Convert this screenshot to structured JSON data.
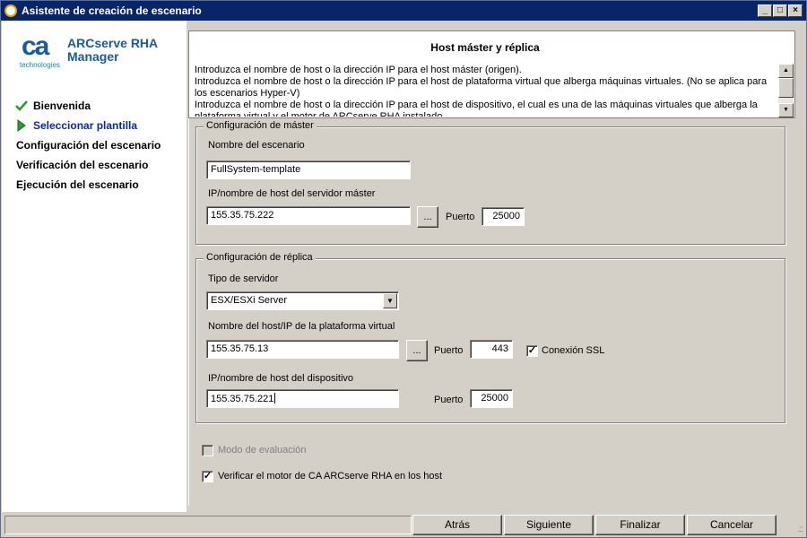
{
  "window": {
    "title": "Asistente de creación de escenario",
    "controls": {
      "minimize": "_",
      "maximize": "□",
      "close": "×"
    }
  },
  "logo": {
    "mark": "ca",
    "sub": "technologies",
    "product_line1": "ARCserve RHA",
    "product_line2": "Manager"
  },
  "nav": {
    "items": [
      {
        "label": "Bienvenida",
        "state": "done",
        "icon": "checkmark-icon"
      },
      {
        "label": "Seleccionar plantilla",
        "state": "current",
        "icon": "arrow-right-icon"
      },
      {
        "label": "Configuración del escenario",
        "state": "pending"
      },
      {
        "label": "Verificación del escenario",
        "state": "pending"
      },
      {
        "label": "Ejecución del escenario",
        "state": "pending"
      }
    ]
  },
  "header": {
    "title": "Host máster y réplica",
    "description_lines": [
      "Introduzca el nombre de host o la dirección IP para el host máster (origen).",
      "Introduzca el nombre de host o la dirección IP para el host de plataforma virtual que alberga máquinas virtuales. (No se aplica para los escenarios Hyper-V)",
      "Introduzca el nombre de host o la dirección IP para el host de dispositivo, el cual es una de las máquinas virtuales que alberga la plataforma virtual y el motor de ARCserve RHA instalado."
    ]
  },
  "master": {
    "group_label": "Configuración de máster",
    "scenario_name_label": "Nombre del escenario",
    "scenario_name_value": "FullSystem-template",
    "host_label": "IP/nombre de host del servidor máster",
    "host_value": "155.35.75.222",
    "browse_label": "...",
    "port_label": "Puerto",
    "port_value": "25000"
  },
  "replica": {
    "group_label": "Configuración de réplica",
    "server_type_label": "Tipo de servidor",
    "server_type_value": "ESX/ESXi Server",
    "virtual_host_label": "Nombre del host/IP de la plataforma virtual",
    "virtual_host_value": "155.35.75.13",
    "browse_label": "...",
    "virtual_port_label": "Puerto",
    "virtual_port_value": "443",
    "ssl_label": "Conexión SSL",
    "ssl_checked": true,
    "appliance_label": "IP/nombre de host del dispositivo",
    "appliance_value": "155.35.75.221",
    "appliance_port_label": "Puerto",
    "appliance_port_value": "25000"
  },
  "options": {
    "evaluation_mode_label": "Modo de evaluación",
    "evaluation_mode_checked": false,
    "evaluation_mode_enabled": false,
    "verify_engine_label": "Verificar el motor de CA ARCserve RHA en los host",
    "verify_engine_checked": true
  },
  "footer": {
    "back": "Atrás",
    "next": "Siguiente",
    "finish": "Finalizar",
    "cancel": "Cancelar"
  },
  "colors": {
    "titlebar": "#0a246a",
    "brand": "#1a5aa0",
    "nav_active": "#0a2aa0",
    "check_green": "#2e9a2e"
  }
}
